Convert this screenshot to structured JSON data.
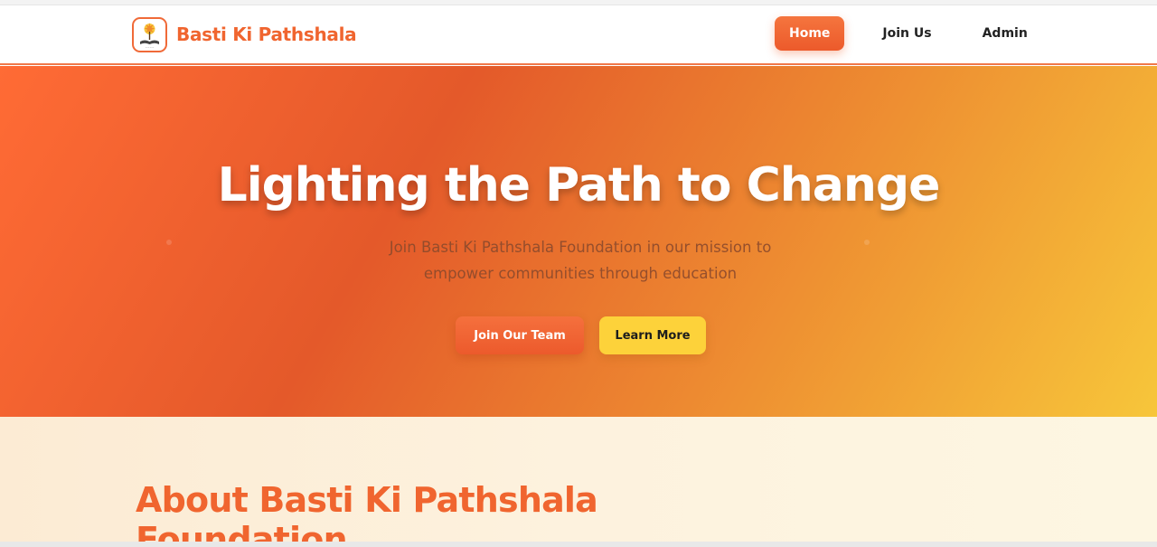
{
  "brand": {
    "name": "Basti Ki Pathshala",
    "logo_icon": "tree-book-logo-icon"
  },
  "nav": {
    "items": [
      {
        "label": "Home",
        "active": true
      },
      {
        "label": "Join Us",
        "active": false
      },
      {
        "label": "Admin",
        "active": false
      }
    ]
  },
  "hero": {
    "title": "Lighting the Path to Change",
    "subtitle": "Join Basti Ki Pathshala Foundation in our mission to empower communities through education",
    "primary_button": "Join Our Team",
    "secondary_button": "Learn More"
  },
  "about": {
    "title": "About Basti Ki Pathshala Foundation"
  },
  "colors": {
    "accent": "#f0652f",
    "hero_gradient_start": "#ff6b35",
    "hero_gradient_end": "#f7c63a",
    "secondary_button": "#fdd23a"
  }
}
